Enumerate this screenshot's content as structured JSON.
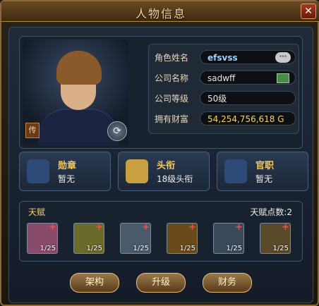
{
  "window": {
    "title": "人物信息",
    "close_icon": "close-icon"
  },
  "portrait": {
    "tag_label": "传"
  },
  "info": {
    "rows": [
      {
        "label": "角色姓名",
        "value": "efsvss"
      },
      {
        "label": "公司名称",
        "value": "sadwff"
      },
      {
        "label": "公司等级",
        "value": "50级"
      },
      {
        "label": "拥有财富",
        "value": "54,254,756,618 G"
      }
    ]
  },
  "cards": [
    {
      "title": "勋章",
      "value": "暂无",
      "icon": "medal-icon"
    },
    {
      "title": "头衔",
      "value": "18级头衔",
      "icon": "book-icon"
    },
    {
      "title": "官职",
      "value": "暂无",
      "icon": "person-icon"
    }
  ],
  "talent": {
    "label": "天赋",
    "points": "天赋点数:2",
    "slots": [
      {
        "icon": "brain-icon",
        "count": "1/25",
        "color": "#8a4a6a"
      },
      {
        "icon": "engineer-icon",
        "count": "1/25",
        "color": "#6a6a2a"
      },
      {
        "icon": "hand-icon",
        "count": "1/25",
        "color": "#4a5a6a"
      },
      {
        "icon": "wrench-icon",
        "count": "1/25",
        "color": "#6a4a1a"
      },
      {
        "icon": "wheel-icon",
        "count": "1/25",
        "color": "#3a4a5a"
      },
      {
        "icon": "magnifier-icon",
        "count": "1/25",
        "color": "#5a4a2a"
      }
    ]
  },
  "buttons": {
    "structure": "架构",
    "upgrade": "升级",
    "finance": "财务"
  }
}
